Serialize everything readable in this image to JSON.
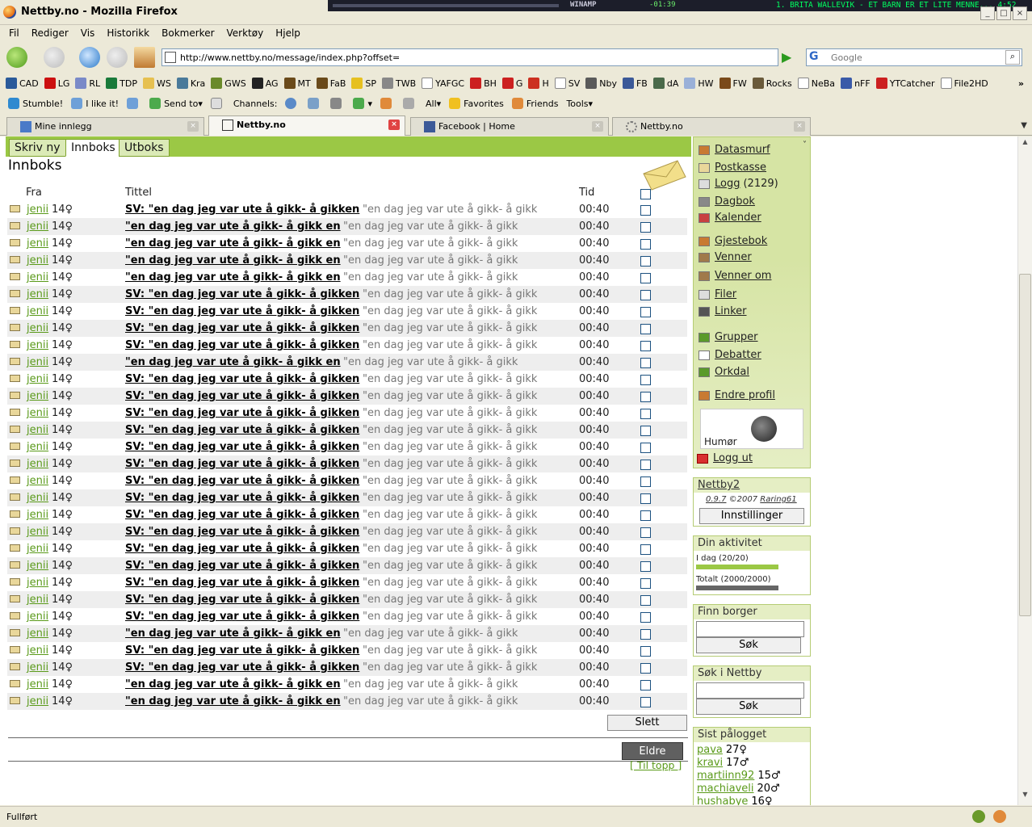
{
  "window": {
    "title": "Nettby.no - Mozilla Firefox",
    "winamp_label": "WINAMP",
    "winamp_time": "-01:39",
    "winamp_song": "1. BRITA WALLEVIK - ET BARN ER ET LITE MENNE...   4:52"
  },
  "menubar": [
    "Fil",
    "Rediger",
    "Vis",
    "Historikk",
    "Bokmerker",
    "Verktøy",
    "Hjelp"
  ],
  "navbar": {
    "url": "http://www.nettby.no/message/index.php?offset=",
    "search_placeholder": "Google"
  },
  "bookmarks": [
    {
      "label": "CAD",
      "icon": "cad-icon",
      "color": "#2a5a9a"
    },
    {
      "label": "LG",
      "icon": "heart-icon",
      "color": "#cc1010"
    },
    {
      "label": "RL",
      "icon": "disc-icon",
      "color": "#7a8ac8"
    },
    {
      "label": "TDP",
      "icon": "tdp-icon",
      "color": "#1a7a3a"
    },
    {
      "label": "WS",
      "icon": "folder-icon",
      "color": "#e6c050"
    },
    {
      "label": "Kra",
      "icon": "kra-icon",
      "color": "#4a7a9a"
    },
    {
      "label": "GWS",
      "icon": "gws-icon",
      "color": "#6a8a2a"
    },
    {
      "label": "AG",
      "icon": "power-icon",
      "color": "#222222"
    },
    {
      "label": "MT",
      "icon": "mt-icon",
      "color": "#6a4a1a"
    },
    {
      "label": "FaB",
      "icon": "fab-icon",
      "color": "#6a4a1a"
    },
    {
      "label": "SP",
      "icon": "smiley-icon",
      "color": "#e6c020"
    },
    {
      "label": "TWB",
      "icon": "twb-icon",
      "color": "#888888"
    },
    {
      "label": "YAFGC",
      "icon": "page-icon",
      "color": "#ffffff"
    },
    {
      "label": "BH",
      "icon": "gear-icon",
      "color": "#cc2020"
    },
    {
      "label": "G",
      "icon": "gmail-icon",
      "color": "#cc2020"
    },
    {
      "label": "H",
      "icon": "h-icon",
      "color": "#cc3020"
    },
    {
      "label": "SV",
      "icon": "page-icon",
      "color": "#ffffff"
    },
    {
      "label": "Nby",
      "icon": "nettby-icon",
      "color": "#5a5a5a"
    },
    {
      "label": "FB",
      "icon": "facebook-icon",
      "color": "#3b5998"
    },
    {
      "label": "dA",
      "icon": "da-icon",
      "color": "#4a6a4a"
    },
    {
      "label": "HW",
      "icon": "hw-icon",
      "color": "#9ab0d8"
    },
    {
      "label": "FW",
      "icon": "fw-icon",
      "color": "#7a4a1a"
    },
    {
      "label": "Rocks",
      "icon": "rocks-icon",
      "color": "#6a5a3a"
    },
    {
      "label": "NeBa",
      "icon": "page-icon",
      "color": "#ffffff"
    },
    {
      "label": "nFF",
      "icon": "nff-icon",
      "color": "#3a5aa8"
    },
    {
      "label": "YTCatcher",
      "icon": "yt-icon",
      "color": "#cc2020"
    },
    {
      "label": "File2HD",
      "icon": "page-icon",
      "color": "#ffffff"
    }
  ],
  "stumblebar": {
    "stumble": "Stumble!",
    "like": "I like it!",
    "send_to": "Send to",
    "channels": "Channels:",
    "all": "All",
    "favorites": "Favorites",
    "friends": "Friends",
    "tools": "Tools"
  },
  "tabs": [
    {
      "label": "Mine innlegg",
      "active": false
    },
    {
      "label": "Nettby.no",
      "active": true
    },
    {
      "label": "Facebook | Home",
      "active": false
    },
    {
      "label": "Nettby.no",
      "active": false
    }
  ],
  "inbox": {
    "tab_write": "Skriv ny",
    "tab_inbox": "Innboks",
    "tab_outbox": "Utboks",
    "heading": "Innboks",
    "col_from": "Fra",
    "col_title": "Tittel",
    "col_time": "Tid",
    "delete_label": "Slett",
    "older_label": "Eldre",
    "top_label": "[ Til topp ]",
    "messages": [
      {
        "from": "jenii",
        "age": "14♀",
        "title": "SV: \"en dag jeg var ute å gikk- å gikken",
        "preview": "\"en dag jeg var ute å gikk- å gikk",
        "time": "00:40",
        "sv": true
      },
      {
        "from": "jenii",
        "age": "14♀",
        "title": "\"en dag jeg var ute å gikk- å gikk en",
        "preview": "\"en dag jeg var ute å gikk- å gikk",
        "time": "00:40",
        "sv": false
      },
      {
        "from": "jenii",
        "age": "14♀",
        "title": "\"en dag jeg var ute å gikk- å gikk en",
        "preview": "\"en dag jeg var ute å gikk- å gikk",
        "time": "00:40",
        "sv": false
      },
      {
        "from": "jenii",
        "age": "14♀",
        "title": "\"en dag jeg var ute å gikk- å gikk en",
        "preview": "\"en dag jeg var ute å gikk- å gikk",
        "time": "00:40",
        "sv": false
      },
      {
        "from": "jenii",
        "age": "14♀",
        "title": "\"en dag jeg var ute å gikk- å gikk en",
        "preview": "\"en dag jeg var ute å gikk- å gikk",
        "time": "00:40",
        "sv": false
      },
      {
        "from": "jenii",
        "age": "14♀",
        "title": "SV: \"en dag jeg var ute å gikk- å gikken",
        "preview": "\"en dag jeg var ute å gikk- å gikk",
        "time": "00:40",
        "sv": true
      },
      {
        "from": "jenii",
        "age": "14♀",
        "title": "SV: \"en dag jeg var ute å gikk- å gikken",
        "preview": "\"en dag jeg var ute å gikk- å gikk",
        "time": "00:40",
        "sv": true
      },
      {
        "from": "jenii",
        "age": "14♀",
        "title": "SV: \"en dag jeg var ute å gikk- å gikken",
        "preview": "\"en dag jeg var ute å gikk- å gikk",
        "time": "00:40",
        "sv": true
      },
      {
        "from": "jenii",
        "age": "14♀",
        "title": "SV: \"en dag jeg var ute å gikk- å gikken",
        "preview": "\"en dag jeg var ute å gikk- å gikk",
        "time": "00:40",
        "sv": true
      },
      {
        "from": "jenii",
        "age": "14♀",
        "title": "\"en dag jeg var ute å gikk- å gikk en",
        "preview": "\"en dag jeg var ute å gikk- å gikk",
        "time": "00:40",
        "sv": false
      },
      {
        "from": "jenii",
        "age": "14♀",
        "title": "SV: \"en dag jeg var ute å gikk- å gikken",
        "preview": "\"en dag jeg var ute å gikk- å gikk",
        "time": "00:40",
        "sv": true
      },
      {
        "from": "jenii",
        "age": "14♀",
        "title": "SV: \"en dag jeg var ute å gikk- å gikken",
        "preview": "\"en dag jeg var ute å gikk- å gikk",
        "time": "00:40",
        "sv": true
      },
      {
        "from": "jenii",
        "age": "14♀",
        "title": "SV: \"en dag jeg var ute å gikk- å gikken",
        "preview": "\"en dag jeg var ute å gikk- å gikk",
        "time": "00:40",
        "sv": true
      },
      {
        "from": "jenii",
        "age": "14♀",
        "title": "SV: \"en dag jeg var ute å gikk- å gikken",
        "preview": "\"en dag jeg var ute å gikk- å gikk",
        "time": "00:40",
        "sv": true
      },
      {
        "from": "jenii",
        "age": "14♀",
        "title": "SV: \"en dag jeg var ute å gikk- å gikken",
        "preview": "\"en dag jeg var ute å gikk- å gikk",
        "time": "00:40",
        "sv": true
      },
      {
        "from": "jenii",
        "age": "14♀",
        "title": "SV: \"en dag jeg var ute å gikk- å gikken",
        "preview": "\"en dag jeg var ute å gikk- å gikk",
        "time": "00:40",
        "sv": true
      },
      {
        "from": "jenii",
        "age": "14♀",
        "title": "SV: \"en dag jeg var ute å gikk- å gikken",
        "preview": "\"en dag jeg var ute å gikk- å gikk",
        "time": "00:40",
        "sv": true
      },
      {
        "from": "jenii",
        "age": "14♀",
        "title": "SV: \"en dag jeg var ute å gikk- å gikken",
        "preview": "\"en dag jeg var ute å gikk- å gikk",
        "time": "00:40",
        "sv": true
      },
      {
        "from": "jenii",
        "age": "14♀",
        "title": "SV: \"en dag jeg var ute å gikk- å gikken",
        "preview": "\"en dag jeg var ute å gikk- å gikk",
        "time": "00:40",
        "sv": true
      },
      {
        "from": "jenii",
        "age": "14♀",
        "title": "SV: \"en dag jeg var ute å gikk- å gikken",
        "preview": "\"en dag jeg var ute å gikk- å gikk",
        "time": "00:40",
        "sv": true
      },
      {
        "from": "jenii",
        "age": "14♀",
        "title": "SV: \"en dag jeg var ute å gikk- å gikken",
        "preview": "\"en dag jeg var ute å gikk- å gikk",
        "time": "00:40",
        "sv": true
      },
      {
        "from": "jenii",
        "age": "14♀",
        "title": "SV: \"en dag jeg var ute å gikk- å gikken",
        "preview": "\"en dag jeg var ute å gikk- å gikk",
        "time": "00:40",
        "sv": true
      },
      {
        "from": "jenii",
        "age": "14♀",
        "title": "SV: \"en dag jeg var ute å gikk- å gikken",
        "preview": "\"en dag jeg var ute å gikk- å gikk",
        "time": "00:40",
        "sv": true
      },
      {
        "from": "jenii",
        "age": "14♀",
        "title": "SV: \"en dag jeg var ute å gikk- å gikken",
        "preview": "\"en dag jeg var ute å gikk- å gikk",
        "time": "00:40",
        "sv": true
      },
      {
        "from": "jenii",
        "age": "14♀",
        "title": "SV: \"en dag jeg var ute å gikk- å gikken",
        "preview": "\"en dag jeg var ute å gikk- å gikk",
        "time": "00:40",
        "sv": true
      },
      {
        "from": "jenii",
        "age": "14♀",
        "title": "\"en dag jeg var ute å gikk- å gikk en",
        "preview": "\"en dag jeg var ute å gikk- å gikk",
        "time": "00:40",
        "sv": false
      },
      {
        "from": "jenii",
        "age": "14♀",
        "title": "SV: \"en dag jeg var ute å gikk- å gikken",
        "preview": "\"en dag jeg var ute å gikk- å gikk",
        "time": "00:40",
        "sv": true
      },
      {
        "from": "jenii",
        "age": "14♀",
        "title": "SV: \"en dag jeg var ute å gikk- å gikken",
        "preview": "\"en dag jeg var ute å gikk- å gikk",
        "time": "00:40",
        "sv": true
      },
      {
        "from": "jenii",
        "age": "14♀",
        "title": "\"en dag jeg var ute å gikk- å gikk en",
        "preview": "\"en dag jeg var ute å gikk- å gikk",
        "time": "00:40",
        "sv": false
      },
      {
        "from": "jenii",
        "age": "14♀",
        "title": "\"en dag jeg var ute å gikk- å gikk en",
        "preview": "\"en dag jeg var ute å gikk- å gikk",
        "time": "00:40",
        "sv": false
      }
    ]
  },
  "sidebar": {
    "links": [
      {
        "label": "Datasmurf",
        "icon": "home-icon"
      },
      {
        "label": "Postkasse",
        "icon": "mail-icon"
      },
      {
        "label": "Logg",
        "icon": "log-icon",
        "count": "(2129)"
      },
      {
        "label": "Dagbok",
        "icon": "book-icon"
      },
      {
        "label": "Kalender",
        "icon": "calendar-icon"
      },
      {
        "label": "Gjestebok",
        "icon": "pencil-icon"
      },
      {
        "label": "Venner",
        "icon": "friends-icon"
      },
      {
        "label": "Venner om",
        "icon": "friends-about-icon"
      },
      {
        "label": "Filer",
        "icon": "files-icon"
      },
      {
        "label": "Linker",
        "icon": "links-icon"
      },
      {
        "label": "Grupper",
        "icon": "groups-icon"
      },
      {
        "label": "Debatter",
        "icon": "debate-icon"
      },
      {
        "label": "Orkdal",
        "icon": "town-icon"
      },
      {
        "label": "Endre profil",
        "icon": "edit-profile-icon"
      }
    ],
    "humor_label": "Humør",
    "logout": "Logg ut",
    "nettby2": {
      "title": "Nettby2",
      "version": "0.9.7",
      "copyright": "©2007",
      "author": "Raring61",
      "settings": "Innstillinger"
    },
    "activity": {
      "title": "Din aktivitet",
      "today": "I dag (20/20)",
      "today_fraction": 1.0,
      "total": "Totalt (2000/2000)",
      "total_fraction": 1.0
    },
    "find": {
      "title": "Finn borger",
      "button": "Søk"
    },
    "search": {
      "title": "Søk i Nettby",
      "button": "Søk"
    },
    "last": {
      "title": "Sist pålogget",
      "users": [
        {
          "name": "pava",
          "age": "27♀"
        },
        {
          "name": "kravi",
          "age": "17♂"
        },
        {
          "name": "martiinn92",
          "age": "15♂"
        },
        {
          "name": "machiaveli",
          "age": "20♂"
        },
        {
          "name": "hushabye",
          "age": "16♀"
        }
      ]
    }
  },
  "statusbar": {
    "text": "Fullført"
  },
  "colors": {
    "accent_green": "#9bc845",
    "link_green": "#5a9a1a",
    "sidebar_bg": "#d6e4a4"
  }
}
